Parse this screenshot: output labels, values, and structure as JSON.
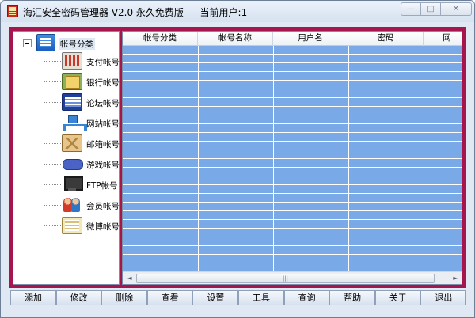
{
  "window": {
    "title": "海汇安全密码管理器 V2.0 永久免费版 --- 当前用户:1",
    "controls": {
      "minimize": "—",
      "maximize": "□",
      "close": "✕"
    }
  },
  "tree": {
    "root": {
      "label": "帐号分类",
      "icon": "list-icon",
      "expanded": true
    },
    "items": [
      {
        "label": "支付帐号",
        "icon": "calculator-icon"
      },
      {
        "label": "银行帐号",
        "icon": "bank-card-icon"
      },
      {
        "label": "论坛帐号",
        "icon": "forum-window-icon"
      },
      {
        "label": "网站帐号",
        "icon": "network-icon"
      },
      {
        "label": "邮箱帐号",
        "icon": "envelope-icon"
      },
      {
        "label": "游戏帐号",
        "icon": "gamepad-icon"
      },
      {
        "label": "FTP帐号",
        "icon": "computer-icon"
      },
      {
        "label": "会员帐号",
        "icon": "users-icon"
      },
      {
        "label": "微博帐号",
        "icon": "document-icon"
      }
    ]
  },
  "grid": {
    "columns": [
      "帐号分类",
      "帐号名称",
      "用户名",
      "密码",
      "网"
    ],
    "row_color": "#7aa9e8",
    "rows": []
  },
  "scrollbar": {
    "left": "◄",
    "right": "►",
    "grip": "|||"
  },
  "toolbar": {
    "buttons": [
      "添加",
      "修改",
      "删除",
      "查看",
      "设置",
      "工具",
      "查询",
      "帮助",
      "关于",
      "退出"
    ]
  },
  "colors": {
    "frame": "#a5164f",
    "grid_row": "#7aa9e8"
  }
}
